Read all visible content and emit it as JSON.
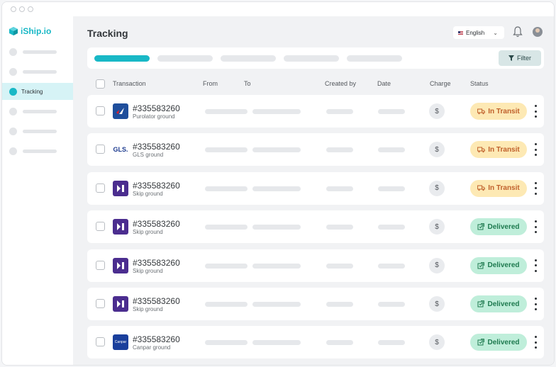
{
  "app": {
    "brand": "iShip.io"
  },
  "sidebar": {
    "items": [
      {
        "label": "",
        "active": false
      },
      {
        "label": "",
        "active": false
      },
      {
        "label": "Tracking",
        "active": true
      },
      {
        "label": "",
        "active": false
      },
      {
        "label": "",
        "active": false
      },
      {
        "label": "",
        "active": false
      }
    ]
  },
  "header": {
    "title": "Tracking",
    "language": "English"
  },
  "toolbar": {
    "filter_label": "Filter"
  },
  "table": {
    "columns": [
      "Transaction",
      "From",
      "To",
      "Created by",
      "Date",
      "Charge",
      "Status"
    ],
    "rows": [
      {
        "number": "#335583260",
        "carrier": "Purolator ground",
        "logo": "purolator-logo",
        "status": "In Transit",
        "status_type": "transit"
      },
      {
        "number": "#335583260",
        "carrier": "GLS ground",
        "logo": "gls-logo",
        "logo_text": "GLS.",
        "status": "In Transit",
        "status_type": "transit"
      },
      {
        "number": "#335583260",
        "carrier": "Skip ground",
        "logo": "skip-logo",
        "status": "In Transit",
        "status_type": "transit"
      },
      {
        "number": "#335583260",
        "carrier": "Skip ground",
        "logo": "skip-logo",
        "status": "Delivered",
        "status_type": "delivered"
      },
      {
        "number": "#335583260",
        "carrier": "Skip ground",
        "logo": "skip-logo",
        "status": "Delivered",
        "status_type": "delivered"
      },
      {
        "number": "#335583260",
        "carrier": "Skip ground",
        "logo": "skip-logo",
        "status": "Delivered",
        "status_type": "delivered"
      },
      {
        "number": "#335583260",
        "carrier": "Canpar ground",
        "logo": "canpar-logo",
        "logo_text": "Canpar",
        "status": "Delivered",
        "status_type": "delivered"
      }
    ]
  },
  "charge_symbol": "$",
  "colors": {
    "accent": "#19b8c6",
    "transit_bg": "#fde9b4",
    "transit_text": "#c0602b",
    "delivered_bg": "#bfeeda",
    "delivered_text": "#1e7a4f"
  }
}
